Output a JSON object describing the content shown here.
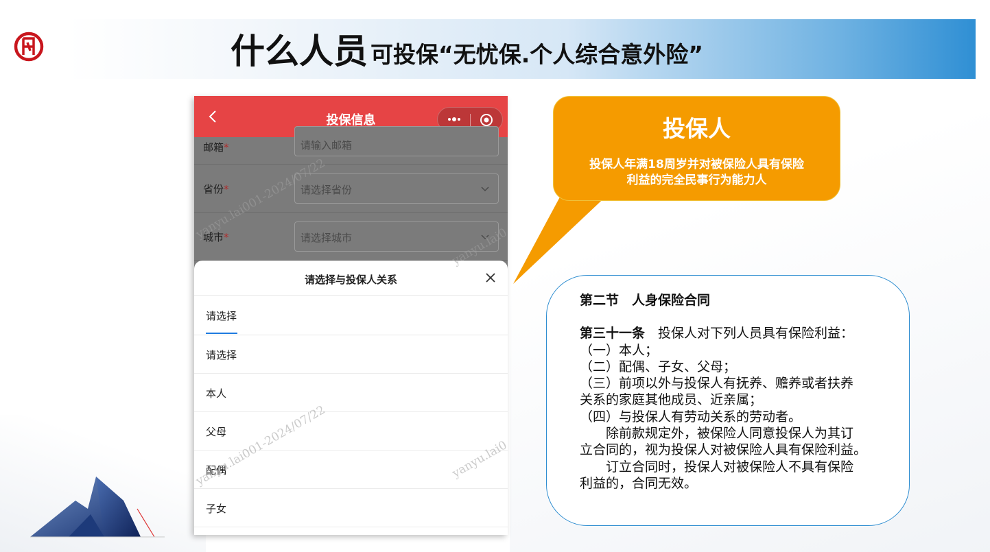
{
  "slide": {
    "title_big": "什么人员",
    "title_small": "可投保“无忧保.个人综合意外险”"
  },
  "phone": {
    "nav_title": "投保信息",
    "form_fields": [
      {
        "label": "邮箱",
        "required_mark": "*",
        "placeholder": "请输入邮箱",
        "has_dropdown": false
      },
      {
        "label": "省份",
        "required_mark": "*",
        "placeholder": "请选择省份",
        "has_dropdown": true
      },
      {
        "label": "城市",
        "required_mark": "*",
        "placeholder": "请选择城市",
        "has_dropdown": true
      }
    ],
    "sheet": {
      "title": "请选择与投保人关系",
      "active_tab": "请选择",
      "options": [
        "请选择",
        "本人",
        "父母",
        "配偶",
        "子女"
      ]
    },
    "watermarks": [
      "yanyu.lai001-2024/07/22",
      "yanyu.lai0",
      "yanyu.lai001-2024/07/22",
      "yanyu.lai0"
    ]
  },
  "callout": {
    "title": "投保人",
    "body_line1": "投保人年满18周岁并对被保险人具有保险",
    "body_line2": "利益的完全民事行为能力人"
  },
  "law": {
    "section": "第二节　人身保险合同",
    "article_num": "第三十一条",
    "article_intro": "　投保人对下列人员具有保险利益：",
    "lines": [
      "（一）本人；",
      "（二）配偶、子女、父母；",
      "（三）前项以外与投保人有抚养、赡养或者扶养",
      "关系的家庭其他成员、近亲属；",
      "（四）与投保人有劳动关系的劳动者。",
      "　　除前款规定外，被保险人同意投保人为其订",
      "立合同的，视为投保人对被保险人具有保险利益。",
      "　　订立合同时，投保人对被保险人不具有保险",
      "利益的，合同无效。"
    ]
  },
  "colors": {
    "navbar": "#e64445",
    "callout": "#f59b00",
    "law_border": "#2f8ed1",
    "tab_underline": "#1e7ae0",
    "logo": "#c8161d"
  }
}
